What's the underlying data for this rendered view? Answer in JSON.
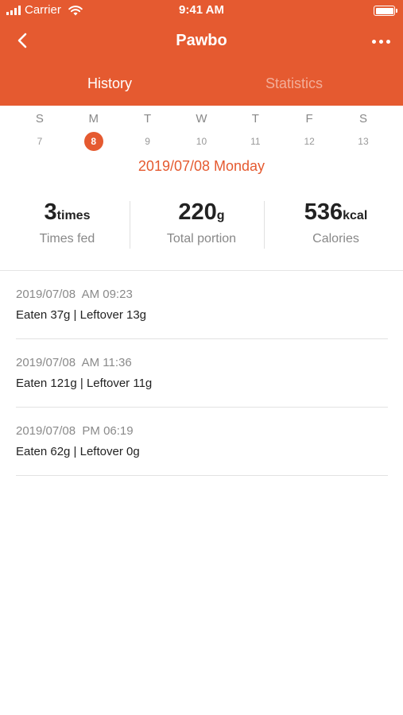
{
  "status_bar": {
    "carrier": "Carrier",
    "time": "9:41 AM",
    "signal_icon": "signal-bars-icon",
    "wifi_icon": "wifi-icon",
    "battery_icon": "battery-icon",
    "battery_level": 1.0
  },
  "nav": {
    "title": "Pawbo",
    "back_icon": "chevron-left-icon",
    "more_icon": "more-horizontal-icon"
  },
  "tabs": [
    {
      "label": "History",
      "active": true
    },
    {
      "label": "Statistics",
      "active": false
    }
  ],
  "week": {
    "days": [
      {
        "letter": "S",
        "num": "7"
      },
      {
        "letter": "M",
        "num": "8",
        "selected": true
      },
      {
        "letter": "T",
        "num": "9"
      },
      {
        "letter": "W",
        "num": "10"
      },
      {
        "letter": "T",
        "num": "11"
      },
      {
        "letter": "F",
        "num": "12"
      },
      {
        "letter": "S",
        "num": "13"
      }
    ],
    "selected_label": "2019/07/08 Monday"
  },
  "summary": [
    {
      "value": "3",
      "unit": "times",
      "label": "Times fed"
    },
    {
      "value": "220",
      "unit": "g",
      "label": "Total portion"
    },
    {
      "value": "536",
      "unit": "kcal",
      "label": "Calories"
    }
  ],
  "records": [
    {
      "time": "2019/07/08  AM 09:23",
      "detail": "Eaten 37g | Leftover 13g"
    },
    {
      "time": "2019/07/08  AM 11:36",
      "detail": "Eaten 121g | Leftover 11g"
    },
    {
      "time": "2019/07/08  PM 06:19",
      "detail": "Eaten 62g | Leftover 0g"
    }
  ],
  "colors": {
    "accent": "#e55a30",
    "text_primary": "#222222",
    "text_secondary": "#888888"
  }
}
